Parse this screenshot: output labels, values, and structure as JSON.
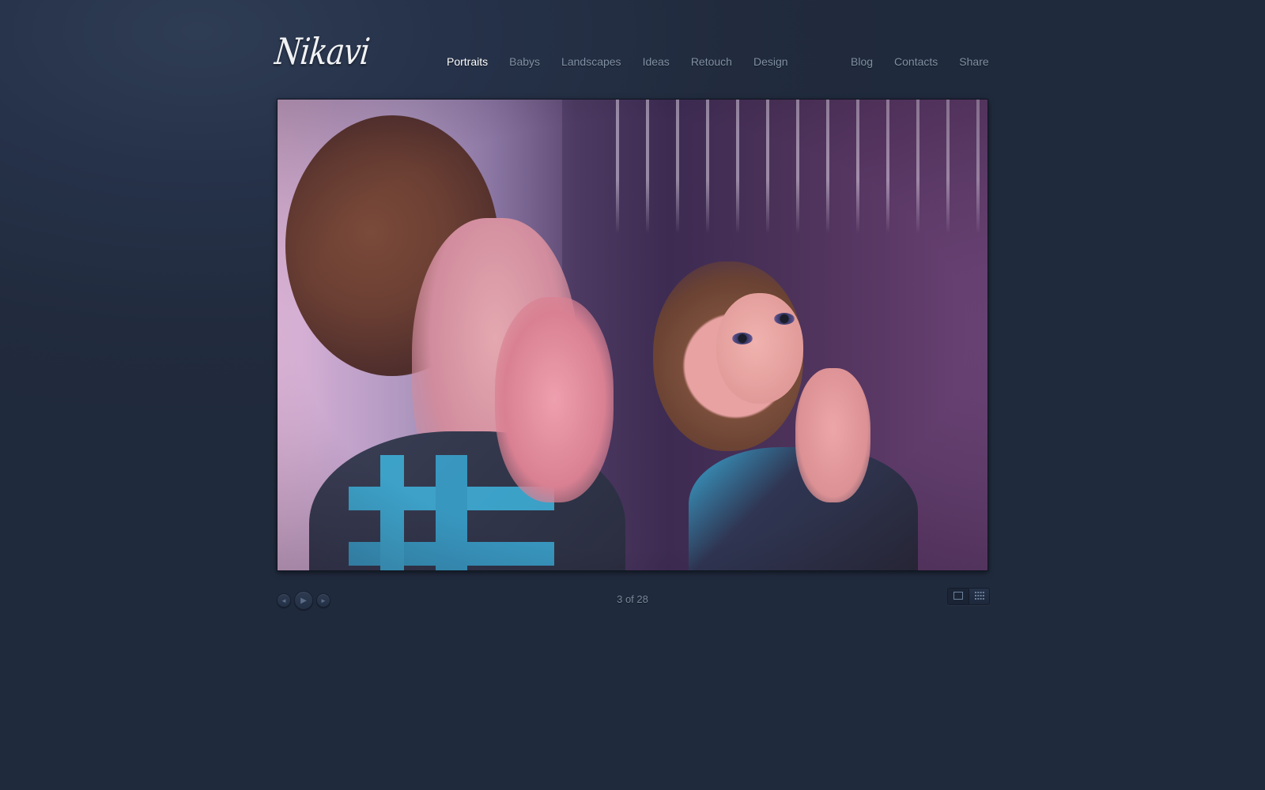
{
  "brand": {
    "logo_text": "Nikavi"
  },
  "nav": {
    "primary": [
      {
        "label": "Portraits",
        "active": true
      },
      {
        "label": "Babys",
        "active": false
      },
      {
        "label": "Landscapes",
        "active": false
      },
      {
        "label": "Ideas",
        "active": false
      },
      {
        "label": "Retouch",
        "active": false
      },
      {
        "label": "Design",
        "active": false
      }
    ],
    "secondary": [
      {
        "label": "Blog"
      },
      {
        "label": "Contacts"
      },
      {
        "label": "Share"
      }
    ]
  },
  "slideshow": {
    "counter": "3 of 28",
    "controls": {
      "prev_icon": "◄",
      "play_icon": "▶",
      "next_icon": "►"
    },
    "view_modes": [
      {
        "name": "single-view-icon",
        "active": true
      },
      {
        "name": "grid-view-icon",
        "active": false
      }
    ]
  },
  "colors": {
    "background": "#212b3d",
    "nav_inactive": "#8090a4",
    "nav_active": "#ffffff",
    "counter": "#7a889b"
  }
}
